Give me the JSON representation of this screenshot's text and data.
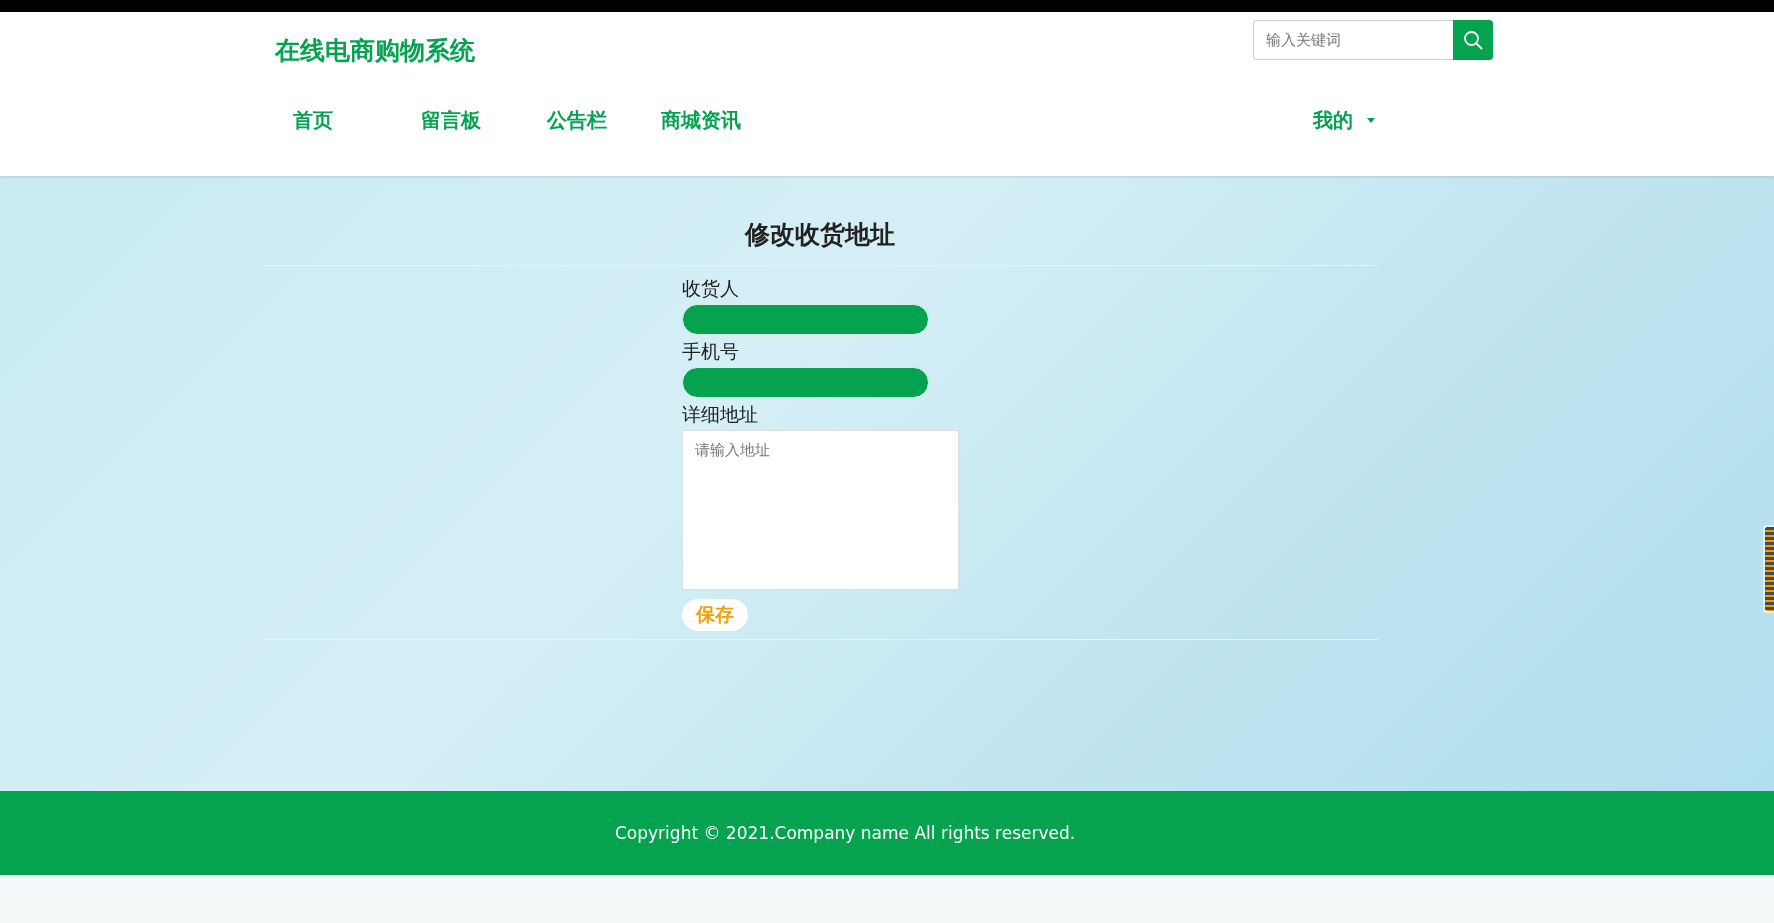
{
  "header": {
    "logo": "在线电商购物系统",
    "search": {
      "placeholder": "输入关键词"
    }
  },
  "nav": {
    "items": [
      {
        "label": "首页"
      },
      {
        "label": "留言板"
      },
      {
        "label": "公告栏"
      },
      {
        "label": "商城资讯"
      }
    ],
    "account": {
      "label": "我的"
    }
  },
  "form": {
    "title": "修改收货地址",
    "fields": [
      {
        "kind": "input",
        "label": "收货人"
      },
      {
        "kind": "input",
        "label": "手机号"
      },
      {
        "kind": "textarea",
        "label": "详细地址",
        "placeholder": "请输入地址"
      }
    ],
    "save_button": "保存"
  },
  "footer": {
    "text": "Copyright © 2021.Company name All rights reserved."
  }
}
